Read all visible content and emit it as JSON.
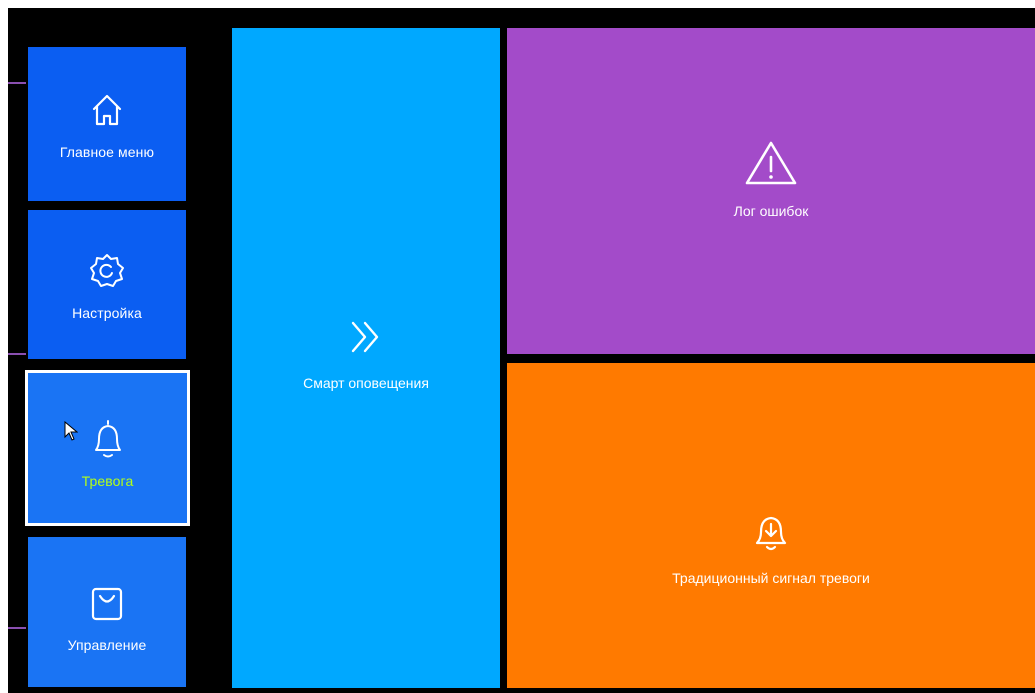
{
  "sidebar": {
    "items": [
      {
        "label": "Главное меню",
        "icon": "home-icon",
        "color": "#0b5ef2"
      },
      {
        "label": "Настройка",
        "icon": "gear-icon",
        "color": "#0b5ef2"
      },
      {
        "label": "Тревога",
        "icon": "bell-icon",
        "color": "#1a74f4",
        "selected": true,
        "label_color": "#b4ff18"
      },
      {
        "label": "Управление",
        "icon": "bag-icon",
        "color": "#1a74f4"
      }
    ]
  },
  "tiles": {
    "smart": {
      "label": "Смарт оповещения",
      "icon": "double-chevron-right-icon",
      "color": "#00a8ff"
    },
    "log": {
      "label": "Лог ошибок",
      "icon": "warning-triangle-icon",
      "color": "#a34bc9"
    },
    "traditional": {
      "label": "Традиционный сигнал тревоги",
      "icon": "bell-download-icon",
      "color": "#ff7a00"
    }
  }
}
